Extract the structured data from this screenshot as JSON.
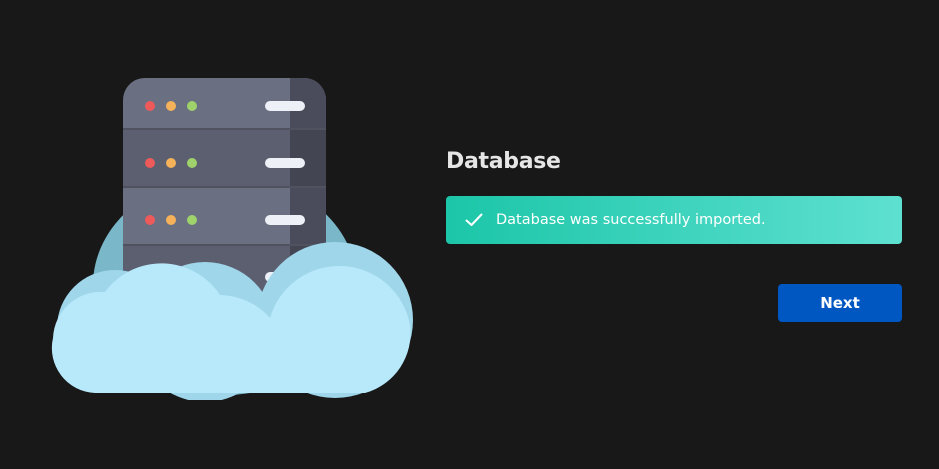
{
  "section": {
    "title": "Database"
  },
  "alert": {
    "icon": "check-icon",
    "message": "Database was successfully imported.",
    "gradient_start": "#1cc6a8",
    "gradient_end": "#5ee0d0"
  },
  "actions": {
    "next_label": "Next",
    "next_color": "#0057c2"
  },
  "illustration": {
    "icon": "database-server-cloud-icon"
  }
}
